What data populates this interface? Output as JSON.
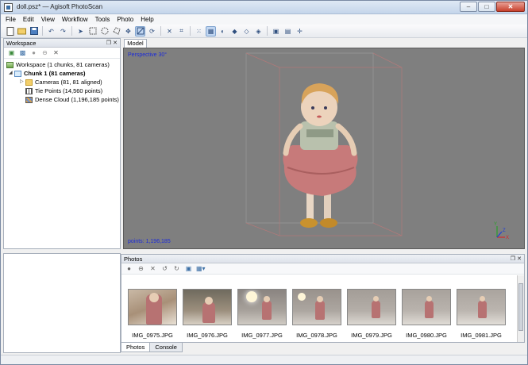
{
  "window": {
    "title": "doll.psz* — Agisoft PhotoScan",
    "minimize": "–",
    "maximize": "□",
    "close": "✕"
  },
  "menubar": {
    "items": [
      "File",
      "Edit",
      "View",
      "Workflow",
      "Tools",
      "Photo",
      "Help"
    ]
  },
  "workspace": {
    "title": "Workspace",
    "float_btn": "❐",
    "close_btn": "✕",
    "tree": {
      "root": "Workspace (1 chunks, 81 cameras)",
      "chunk": "Chunk 1 (81 cameras)",
      "cameras": "Cameras (81, 81 aligned)",
      "tie_points": "Tie Points (14,560 points)",
      "dense_cloud": "Dense Cloud (1,196,185 points)"
    }
  },
  "model": {
    "tab": "Model",
    "perspective": "Perspective 30°",
    "points": "points: 1,196,185",
    "axes": {
      "x": "X",
      "y": "Y",
      "z": "Z"
    }
  },
  "photos": {
    "title": "Photos",
    "float_btn": "❐",
    "close_btn": "✕",
    "items": [
      {
        "name": "IMG_0975.JPG"
      },
      {
        "name": "IMG_0976.JPG"
      },
      {
        "name": "IMG_0977.JPG"
      },
      {
        "name": "IMG_0978.JPG"
      },
      {
        "name": "IMG_0979.JPG"
      },
      {
        "name": "IMG_0980.JPG"
      },
      {
        "name": "IMG_0981.JPG"
      }
    ]
  },
  "bottom_tabs": {
    "photos": "Photos",
    "console": "Console"
  }
}
